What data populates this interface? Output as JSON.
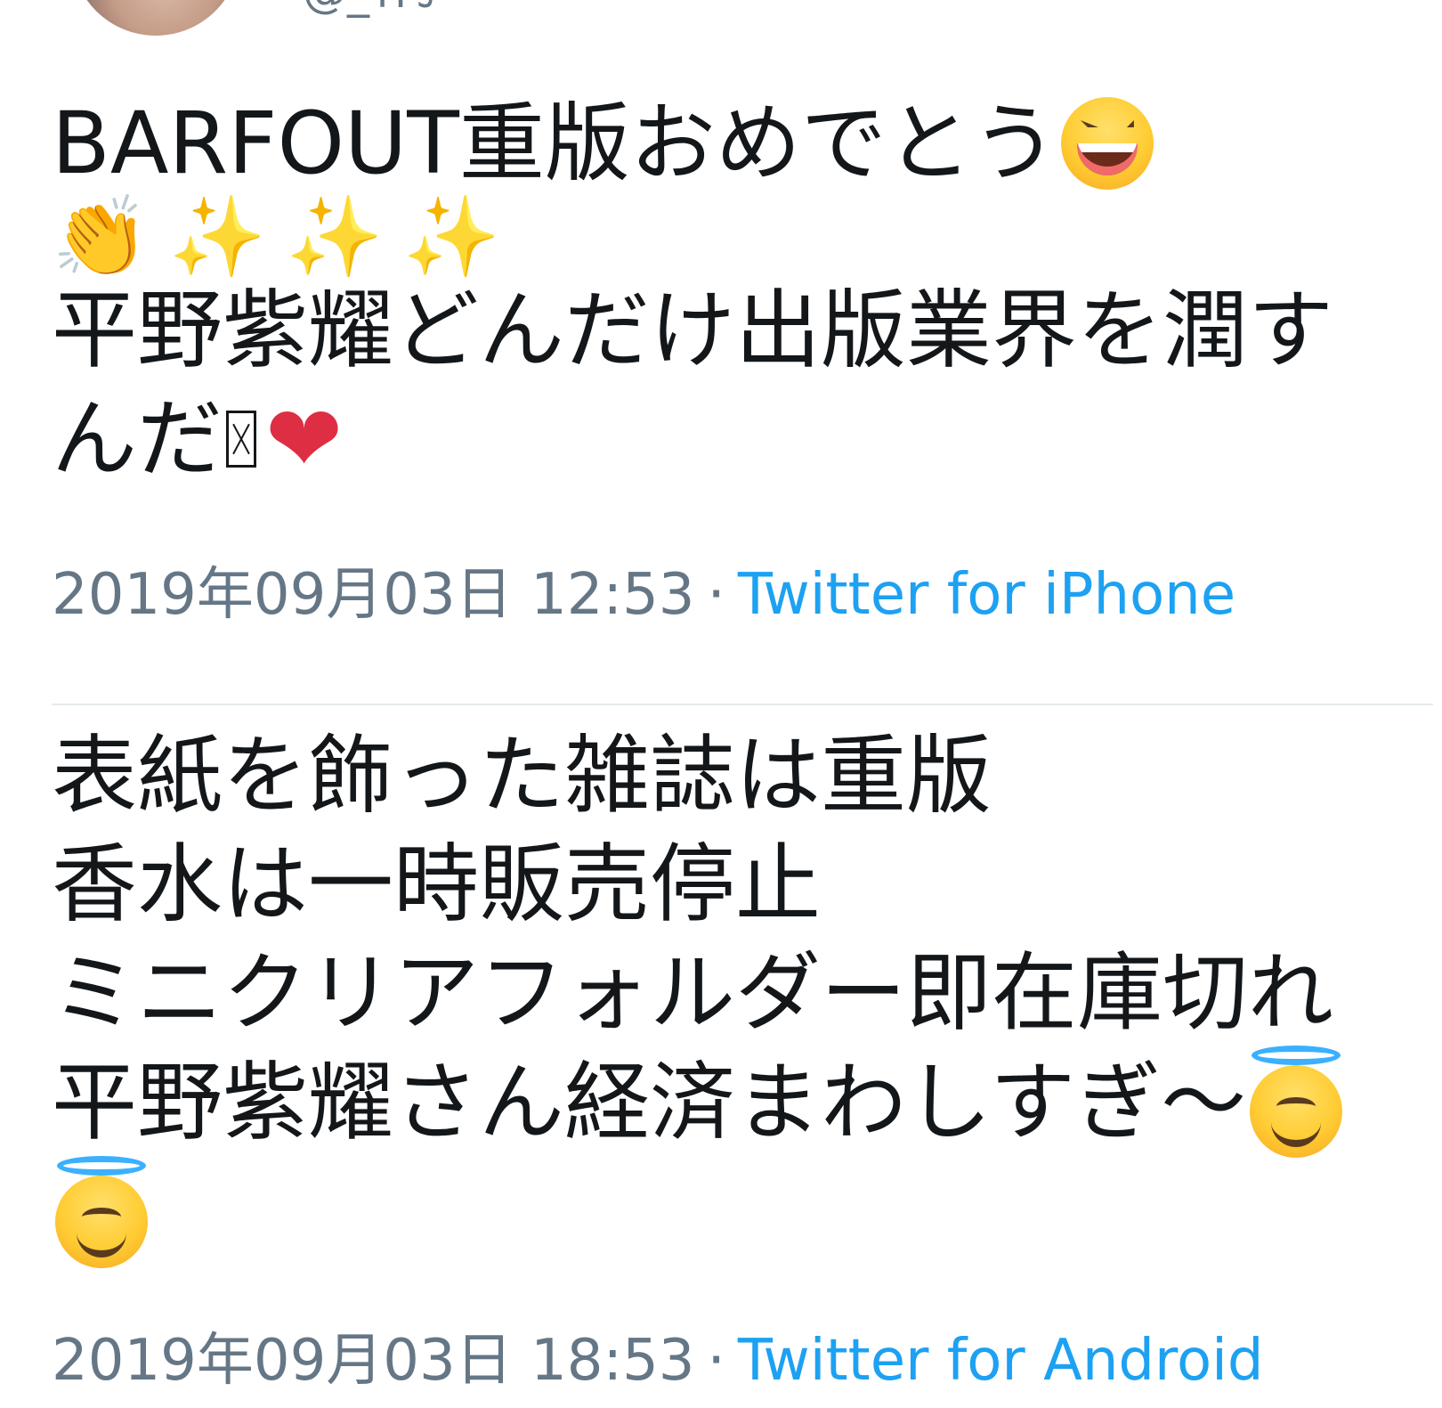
{
  "header": {
    "handle_fragment": "@_ᴛᴘᴊ"
  },
  "tweets": [
    {
      "lines": [
        {
          "text": "BARFOUT重版おめでとう",
          "emoji": "laughing-face-emoji"
        },
        {
          "emoji_row": [
            "clapping-hands-emoji",
            "sparkles-emoji",
            "sparkles-emoji",
            "sparkles-emoji"
          ]
        },
        {
          "text": "平野紫耀どんだけ出版業界を潤す"
        },
        {
          "text": "んだ",
          "emoji": "red-heart-emoji"
        }
      ],
      "timestamp": "2019年09月03日 12:53",
      "separator": "·",
      "source": "Twitter for iPhone"
    },
    {
      "lines": [
        {
          "text": "表紙を飾った雑誌は重版"
        },
        {
          "text": "香水は一時販売停止"
        },
        {
          "text": "ミニクリアフォルダー即在庫切れ"
        },
        {
          "text": "平野紫耀さん経済まわしすぎ〜",
          "emoji": "smiling-face-with-halo-emoji"
        },
        {
          "emoji": "smiling-face-with-halo-emoji"
        }
      ],
      "timestamp": "2019年09月03日 18:53",
      "separator": "·",
      "source": "Twitter for Android"
    }
  ],
  "colors": {
    "text": "#14171a",
    "meta": "#657786",
    "link": "#1da1f2",
    "divider": "#e6ecf0",
    "heart": "#dd2e44",
    "halo": "#3ab0ff"
  },
  "glyphs": {
    "clap": "👏",
    "sparkle": "✨",
    "heart": "❤"
  }
}
